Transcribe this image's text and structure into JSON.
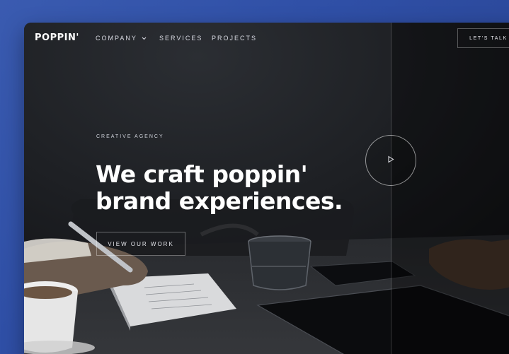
{
  "brand": {
    "logo": "POPPIN'"
  },
  "nav": {
    "items": [
      {
        "label": "COMPANY"
      },
      {
        "label": "SERVICES"
      },
      {
        "label": "PROJECTS"
      }
    ],
    "cta_label": "LET'S TALK"
  },
  "hero": {
    "eyebrow": "CREATIVE AGENCY",
    "headline_line1": "We craft poppin'",
    "headline_line2": "brand experiences.",
    "cta_label": "VIEW OUR WORK"
  },
  "icons": {
    "company_dropdown": "chevron-down-icon",
    "video": "play-icon"
  },
  "colors": {
    "background_frame": "#3a5bb0",
    "hero_overlay": "#121418",
    "text_primary": "#ffffff"
  }
}
